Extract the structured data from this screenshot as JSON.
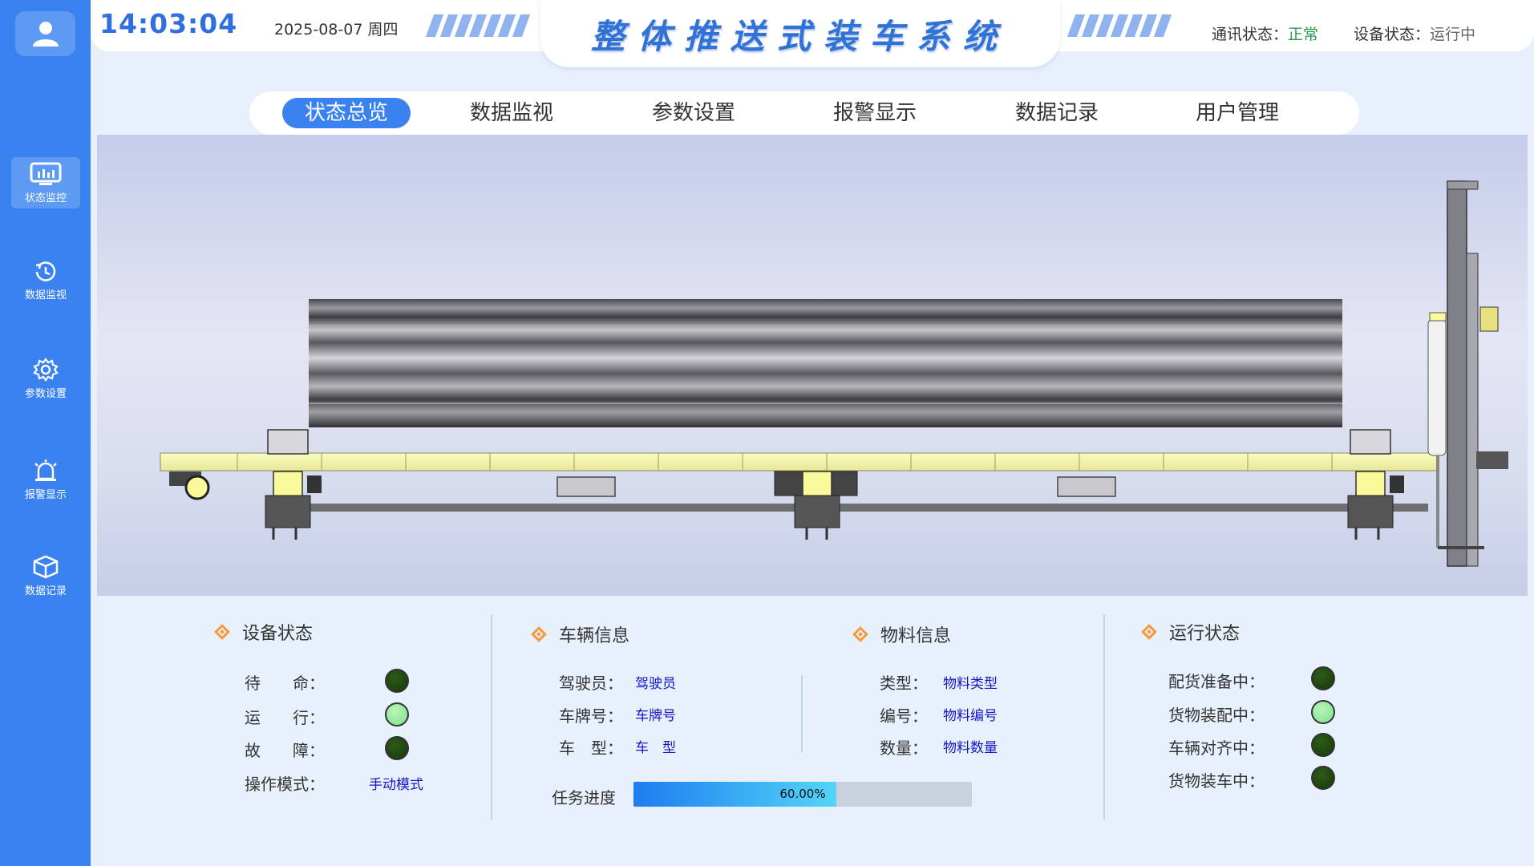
{
  "header": {
    "clock": "14:03:04",
    "date": "2025-08-07 周四",
    "title": "整体推送式装车系统",
    "comm_label": "通讯状态：",
    "comm_value": "正常",
    "device_label": "设备状态：",
    "device_value": "运行中"
  },
  "sidebar": {
    "items": [
      {
        "label": "状态监控",
        "icon": "monitor-icon",
        "active": true
      },
      {
        "label": "数据监视",
        "icon": "history-icon",
        "active": false
      },
      {
        "label": "参数设置",
        "icon": "gear-icon",
        "active": false
      },
      {
        "label": "报警显示",
        "icon": "alarm-icon",
        "active": false
      },
      {
        "label": "数据记录",
        "icon": "box-icon",
        "active": false
      }
    ]
  },
  "nav": {
    "tabs": [
      {
        "label": "状态总览",
        "active": true
      },
      {
        "label": "数据监视",
        "active": false
      },
      {
        "label": "参数设置",
        "active": false
      },
      {
        "label": "报警显示",
        "active": false
      },
      {
        "label": "数据记录",
        "active": false
      },
      {
        "label": "用户管理",
        "active": false
      }
    ]
  },
  "device_status": {
    "title": "设备状态",
    "standby_label": "待　　命：",
    "standby_on": false,
    "running_label": "运　　行：",
    "running_on": true,
    "fault_label": "故　　障：",
    "fault_on": false,
    "mode_label": "操作模式：",
    "mode_value": "手动模式"
  },
  "vehicle_info": {
    "title": "车辆信息",
    "driver_label": "驾驶员：",
    "driver_value": "驾驶员",
    "plate_label": "车牌号：",
    "plate_value": "车牌号",
    "type_label": "车　型：",
    "type_value": "车　型"
  },
  "material_info": {
    "title": "物料信息",
    "kind_label": "类型：",
    "kind_value": "物料类型",
    "code_label": "编号：",
    "code_value": "物料编号",
    "qty_label": "数量：",
    "qty_value": "物料数量"
  },
  "task": {
    "label": "任务进度",
    "progress_text": "60.00%",
    "progress": 0.6
  },
  "run_status": {
    "title": "运行状态",
    "items": [
      {
        "label": "配货准备中：",
        "on": false
      },
      {
        "label": "货物装配中：",
        "on": true
      },
      {
        "label": "车辆对齐中：",
        "on": false
      },
      {
        "label": "货物装车中：",
        "on": false
      }
    ]
  },
  "colors": {
    "sidebar": "#3a82f0",
    "accent": "#2f6fe0",
    "ok": "#2c9a4a",
    "value_text": "#1515c8",
    "diamond": "#f29a3c"
  }
}
